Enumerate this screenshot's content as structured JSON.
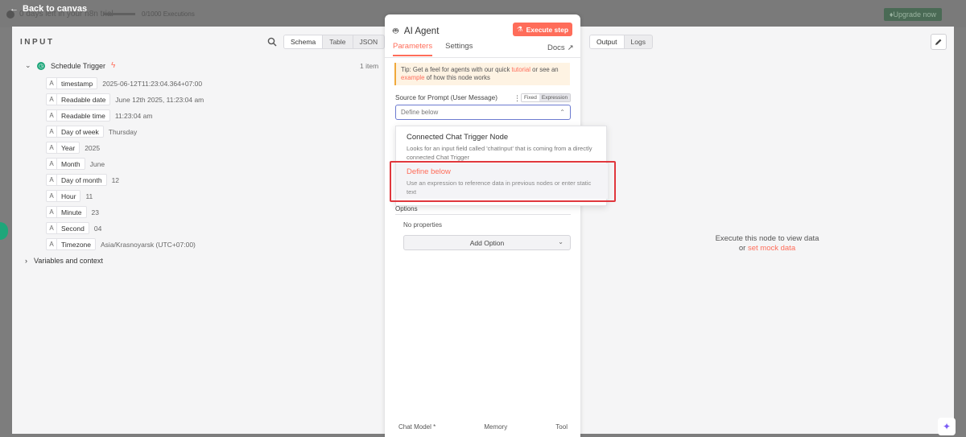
{
  "topbar": {
    "back_label": "Back to canvas",
    "trial_text": "0 days left in your n8n trial",
    "executions_text": "0/1000 Executions",
    "upgrade_label": "Upgrade now"
  },
  "input": {
    "title": "INPUT",
    "view_tabs": [
      "Schema",
      "Table",
      "JSON"
    ],
    "trigger": {
      "name": "Schedule Trigger",
      "count": "1 item"
    },
    "fields": [
      {
        "type": "A",
        "name": "timestamp",
        "value": "2025-06-12T11:23:04.364+07:00"
      },
      {
        "type": "A",
        "name": "Readable date",
        "value": "June 12th 2025, 11:23:04 am"
      },
      {
        "type": "A",
        "name": "Readable time",
        "value": "11:23:04 am"
      },
      {
        "type": "A",
        "name": "Day of week",
        "value": "Thursday"
      },
      {
        "type": "A",
        "name": "Year",
        "value": "2025"
      },
      {
        "type": "A",
        "name": "Month",
        "value": "June"
      },
      {
        "type": "A",
        "name": "Day of month",
        "value": "12"
      },
      {
        "type": "A",
        "name": "Hour",
        "value": "11"
      },
      {
        "type": "A",
        "name": "Minute",
        "value": "23"
      },
      {
        "type": "A",
        "name": "Second",
        "value": "04"
      },
      {
        "type": "A",
        "name": "Timezone",
        "value": "Asia/Krasnoyarsk (UTC+07:00)"
      }
    ],
    "variables_label": "Variables and context"
  },
  "node": {
    "title": "AI Agent",
    "execute_label": "Execute step",
    "tabs": [
      "Parameters",
      "Settings"
    ],
    "docs_label": "Docs",
    "tip": {
      "prefix": "Tip: Get a feel for agents with our quick ",
      "link1": "tutorial",
      "middle": " or see an ",
      "link2": "example",
      "suffix": " of how this node works"
    },
    "source_label": "Source for Prompt (User Message)",
    "mode_fixed": "Fixed",
    "mode_expression": "Expression",
    "select_value": "Define below",
    "dropdown": [
      {
        "title": "Connected Chat Trigger Node",
        "desc": "Looks for an input field called 'chatInput' that is coming from a directly connected Chat Trigger"
      },
      {
        "title": "Define below",
        "desc": "Use an expression to reference data in previous nodes or enter static text"
      }
    ],
    "options_label": "Options",
    "no_properties": "No properties",
    "add_option_label": "Add Option",
    "bottom": [
      "Chat Model *",
      "Memory",
      "Tool"
    ]
  },
  "output": {
    "tabs": [
      "Output",
      "Logs"
    ],
    "empty_line1": "Execute this node to view data",
    "empty_or": "or ",
    "empty_link": "set mock data"
  },
  "colors": {
    "accent": "#ff6d5a",
    "green": "#1ea67a",
    "highlight_box": "#e0373d"
  }
}
